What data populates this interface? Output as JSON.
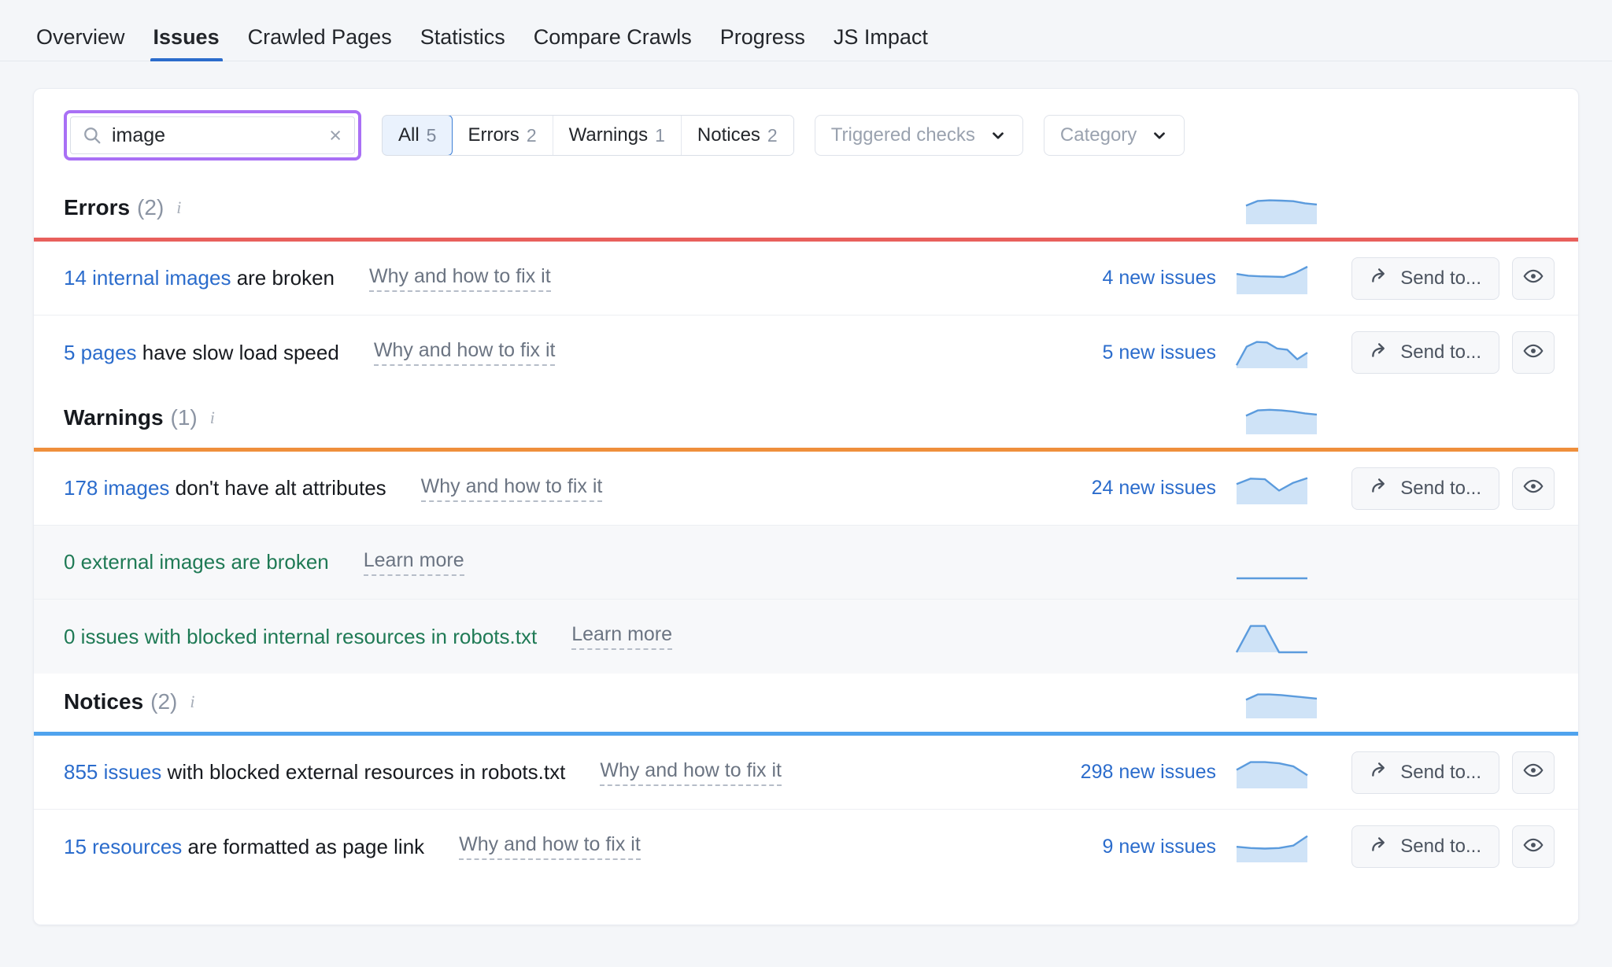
{
  "nav": {
    "tabs": [
      {
        "label": "Overview",
        "active": false
      },
      {
        "label": "Issues",
        "active": true
      },
      {
        "label": "Crawled Pages",
        "active": false
      },
      {
        "label": "Statistics",
        "active": false
      },
      {
        "label": "Compare Crawls",
        "active": false
      },
      {
        "label": "Progress",
        "active": false
      },
      {
        "label": "JS Impact",
        "active": false
      }
    ]
  },
  "colors": {
    "accent_blue": "#2b6ccc",
    "errors_bar": "#e8605c",
    "warnings_bar": "#ef8f3c",
    "notices_bar": "#4fa3ee",
    "search_highlight": "#a970f5",
    "green_text": "#1f7a55",
    "spark_fill": "#cfe3f7",
    "spark_line": "#5b9bdd"
  },
  "search": {
    "value": "image",
    "placeholder": "Search",
    "clear_label": "×"
  },
  "segmented": [
    {
      "label": "All",
      "count": "5",
      "active": true
    },
    {
      "label": "Errors",
      "count": "2",
      "active": false
    },
    {
      "label": "Warnings",
      "count": "1",
      "active": false
    },
    {
      "label": "Notices",
      "count": "2",
      "active": false
    }
  ],
  "dropdowns": [
    {
      "label": "Triggered checks"
    },
    {
      "label": "Category"
    }
  ],
  "sections": [
    {
      "id": "errors",
      "title": "Errors",
      "count": "(2)",
      "info": "i",
      "bar_color": "#e8605c",
      "rows": [
        {
          "lead": "14 internal images",
          "rest": " are broken",
          "link": "Why and how to fix it",
          "new_issues": "4 new issues",
          "send_label": "Send to...",
          "has_actions": true,
          "green": false,
          "muted": false
        },
        {
          "lead": "5 pages",
          "rest": " have slow load speed",
          "link": "Why and how to fix it",
          "new_issues": "5 new issues",
          "send_label": "Send to...",
          "has_actions": true,
          "green": false,
          "muted": false
        }
      ]
    },
    {
      "id": "warnings",
      "title": "Warnings",
      "count": "(1)",
      "info": "i",
      "bar_color": "#ef8f3c",
      "rows": [
        {
          "lead": "178 images",
          "rest": " don't have alt attributes",
          "link": "Why and how to fix it",
          "new_issues": "24 new issues",
          "send_label": "Send to...",
          "has_actions": true,
          "green": false,
          "muted": false
        },
        {
          "lead": "0 external images are broken",
          "rest": "",
          "link": "Learn more",
          "new_issues": "",
          "send_label": "",
          "has_actions": false,
          "green": true,
          "muted": true
        },
        {
          "lead": "0 issues with blocked internal resources in robots.txt",
          "rest": "",
          "link": "Learn more",
          "new_issues": "",
          "send_label": "",
          "has_actions": false,
          "green": true,
          "muted": true
        }
      ]
    },
    {
      "id": "notices",
      "title": "Notices",
      "count": "(2)",
      "info": "i",
      "bar_color": "#4fa3ee",
      "rows": [
        {
          "lead": "855 issues",
          "rest": " with blocked external resources in robots.txt",
          "link": "Why and how to fix it",
          "new_issues": "298 new issues",
          "send_label": "Send to...",
          "has_actions": true,
          "green": false,
          "muted": false
        },
        {
          "lead": "15 resources",
          "rest": " are formatted as page link",
          "link": "Why and how to fix it",
          "new_issues": "9 new issues",
          "send_label": "Send to...",
          "has_actions": true,
          "green": false,
          "muted": false
        }
      ]
    }
  ],
  "chart_data": [
    {
      "type": "area",
      "name": "errors-section-trend",
      "x": [
        0,
        1,
        2,
        3,
        4,
        5,
        6
      ],
      "values": [
        62,
        78,
        80,
        79,
        77,
        70,
        66
      ],
      "ylim": [
        0,
        100
      ],
      "grid": false
    },
    {
      "type": "area",
      "name": "internal-images-broken-trend",
      "x": [
        0,
        1,
        2,
        3,
        4,
        5,
        6
      ],
      "values": [
        68,
        62,
        60,
        59,
        58,
        72,
        92
      ],
      "ylim": [
        0,
        100
      ],
      "grid": false
    },
    {
      "type": "area",
      "name": "slow-load-speed-trend",
      "x": [
        0,
        1,
        2,
        3,
        4,
        5,
        6
      ],
      "values": [
        10,
        72,
        88,
        86,
        66,
        62,
        30,
        52
      ],
      "ylim": [
        0,
        100
      ],
      "grid": false
    },
    {
      "type": "area",
      "name": "warnings-section-trend",
      "x": [
        0,
        1,
        2,
        3,
        4,
        5,
        6
      ],
      "values": [
        62,
        80,
        82,
        80,
        76,
        70,
        66
      ],
      "ylim": [
        0,
        100
      ],
      "grid": false
    },
    {
      "type": "area",
      "name": "images-no-alt-trend",
      "x": [
        0,
        1,
        2,
        3,
        4,
        5
      ],
      "values": [
        68,
        86,
        84,
        46,
        72,
        88
      ],
      "ylim": [
        0,
        100
      ],
      "grid": false
    },
    {
      "type": "line",
      "name": "external-images-broken-trend",
      "x": [
        0,
        1,
        2,
        3,
        4,
        5
      ],
      "values": [
        0,
        0,
        0,
        0,
        0,
        0
      ],
      "ylim": [
        0,
        100
      ],
      "grid": false
    },
    {
      "type": "area",
      "name": "blocked-internal-resources-trend",
      "x": [
        0,
        1,
        2,
        3,
        4,
        5
      ],
      "values": [
        0,
        88,
        88,
        0,
        0,
        0
      ],
      "ylim": [
        0,
        100
      ],
      "grid": false
    },
    {
      "type": "area",
      "name": "notices-section-trend",
      "x": [
        0,
        1,
        2,
        3,
        4,
        5,
        6
      ],
      "values": [
        62,
        80,
        80,
        78,
        74,
        70,
        66
      ],
      "ylim": [
        0,
        100
      ],
      "grid": false
    },
    {
      "type": "area",
      "name": "blocked-external-resources-trend",
      "x": [
        0,
        1,
        2,
        3,
        4,
        5
      ],
      "values": [
        62,
        88,
        88,
        84,
        74,
        44
      ],
      "ylim": [
        0,
        100
      ],
      "grid": false
    },
    {
      "type": "area",
      "name": "resources-page-link-trend",
      "x": [
        0,
        1,
        2,
        3,
        4,
        5
      ],
      "values": [
        52,
        48,
        46,
        48,
        56,
        88
      ],
      "ylim": [
        0,
        100
      ],
      "grid": false
    }
  ]
}
